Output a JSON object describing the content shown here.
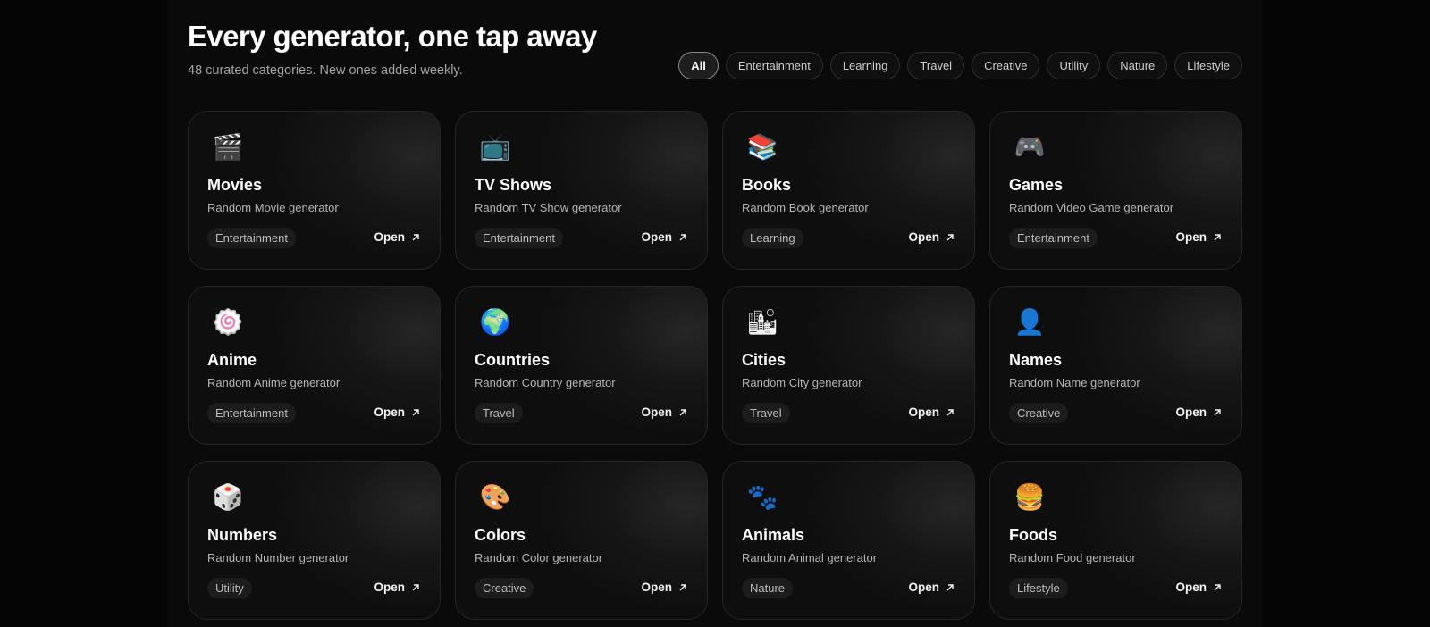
{
  "header": {
    "title": "Every generator, one tap away",
    "subtitle": "48 curated categories. New ones added weekly."
  },
  "filters": [
    {
      "label": "All",
      "active": true
    },
    {
      "label": "Entertainment"
    },
    {
      "label": "Learning"
    },
    {
      "label": "Travel"
    },
    {
      "label": "Creative"
    },
    {
      "label": "Utility"
    },
    {
      "label": "Nature"
    },
    {
      "label": "Lifestyle"
    }
  ],
  "cards": [
    {
      "icon": "clapper-board-icon",
      "emoji": "🎬",
      "name": "Movies",
      "desc": "Random Movie generator",
      "tag": "Entertainment",
      "open": "Open"
    },
    {
      "icon": "television-icon",
      "emoji": "📺",
      "name": "TV Shows",
      "desc": "Random TV Show generator",
      "tag": "Entertainment",
      "open": "Open"
    },
    {
      "icon": "books-icon",
      "emoji": "📚",
      "name": "Books",
      "desc": "Random Book generator",
      "tag": "Learning",
      "open": "Open"
    },
    {
      "icon": "game-controller-icon",
      "emoji": "🎮",
      "name": "Games",
      "desc": "Random Video Game generator",
      "tag": "Entertainment",
      "open": "Open"
    },
    {
      "icon": "fish-cake-icon",
      "emoji": "🍥",
      "name": "Anime",
      "desc": "Random Anime generator",
      "tag": "Entertainment",
      "open": "Open"
    },
    {
      "icon": "globe-icon",
      "emoji": "🌍",
      "name": "Countries",
      "desc": "Random Country generator",
      "tag": "Travel",
      "open": "Open"
    },
    {
      "icon": "cityscape-icon",
      "emoji": "🏙",
      "name": "Cities",
      "desc": "Random City generator",
      "tag": "Travel",
      "open": "Open"
    },
    {
      "icon": "person-silhouette-icon",
      "emoji": "👤",
      "name": "Names",
      "desc": "Random Name generator",
      "tag": "Creative",
      "open": "Open"
    },
    {
      "icon": "dice-icon",
      "emoji": "🎲",
      "name": "Numbers",
      "desc": "Random Number generator",
      "tag": "Utility",
      "open": "Open"
    },
    {
      "icon": "palette-icon",
      "emoji": "🎨",
      "name": "Colors",
      "desc": "Random Color generator",
      "tag": "Creative",
      "open": "Open"
    },
    {
      "icon": "paw-prints-icon",
      "emoji": "🐾",
      "name": "Animals",
      "desc": "Random Animal generator",
      "tag": "Nature",
      "open": "Open"
    },
    {
      "icon": "burger-icon",
      "emoji": "🍔",
      "name": "Foods",
      "desc": "Random Food generator",
      "tag": "Lifestyle",
      "open": "Open"
    }
  ]
}
